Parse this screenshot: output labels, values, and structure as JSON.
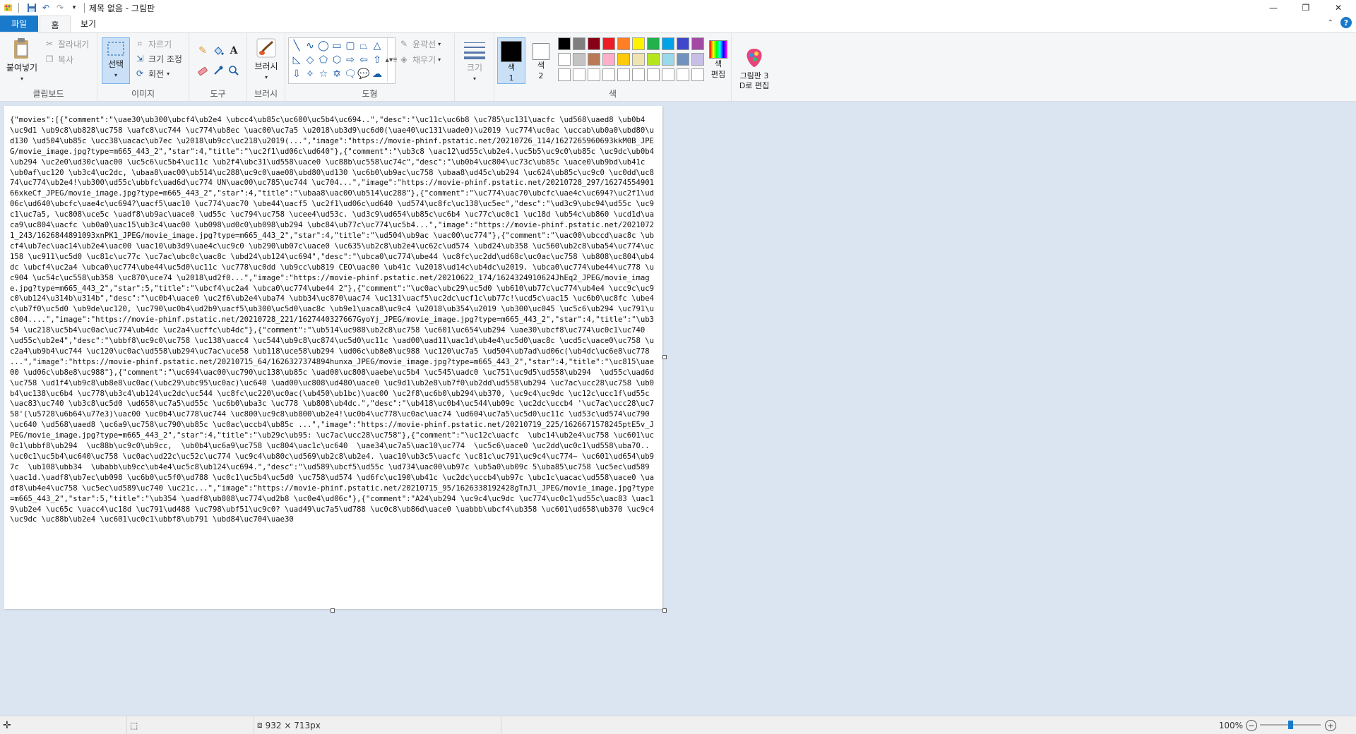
{
  "window": {
    "title": "제목 없음 - 그림판",
    "controls": [
      "—",
      "❐",
      "✕"
    ]
  },
  "tabs": {
    "file": "파일",
    "home": "홈",
    "view": "보기"
  },
  "clipboard": {
    "paste": "붙여넣기",
    "cut": "잘라내기",
    "copy": "복사",
    "label": "클립보드"
  },
  "image": {
    "select": "선택",
    "crop": "자르기",
    "resize": "크기 조정",
    "rotate": "회전",
    "label": "이미지"
  },
  "tools": {
    "label": "도구"
  },
  "brushes": {
    "label": "브러시"
  },
  "shapes": {
    "outline": "윤곽선",
    "fill": "채우기",
    "label": "도형"
  },
  "size": {
    "label": "크기"
  },
  "colors": {
    "color1": "색\n1",
    "color2": "색\n2",
    "edit": "색\n편집",
    "label": "색",
    "palette_row1": [
      "#000000",
      "#7f7f7f",
      "#880015",
      "#ed1c24",
      "#ff7f27",
      "#fff200",
      "#22b14c",
      "#00a2e8",
      "#3f48cc",
      "#a349a4"
    ],
    "palette_row2": [
      "#ffffff",
      "#c3c3c3",
      "#b97a57",
      "#ffaec9",
      "#ffc90e",
      "#efe4b0",
      "#b5e61d",
      "#99d9ea",
      "#7092be",
      "#c8bfe7"
    ],
    "palette_row3": [
      "#ffffff",
      "#ffffff",
      "#ffffff",
      "#ffffff",
      "#ffffff",
      "#ffffff",
      "#ffffff",
      "#ffffff",
      "#ffffff",
      "#ffffff"
    ]
  },
  "paint3d": {
    "label": "그림판 3\nD로 편집"
  },
  "canvas_text": "{\"movies\":[{\"comment\":\"\\uae30\\ub300\\ubcf4\\ub2e4 \\ubcc4\\ub85c\\uc600\\uc5b4\\uc694..\",\"desc\":\"\\uc11c\\uc6b8 \\uc785\\uc131\\uacfc \\ud568\\uaed8 \\ub0b4 \\uc9d1 \\ub9c8\\ub828\\uc758 \\uafc8\\uc744 \\uc774\\ub8ec \\uac00\\uc7a5 \\u2018\\ub3d9\\uc6d0(\\uae40\\uc131\\uade0)\\u2019 \\uc774\\uc0ac \\uccab\\ub0a0\\ubd80\\ud130 \\ud504\\ub85c \\ucc38\\uacac\\ub7ec \\u2018\\ub9cc\\uc218\\u2019(...\",\"image\":\"https://movie-phinf.pstatic.net/20210726_114/1627265960693kkM0B_JPEG/movie_image.jpg?type=m665_443_2\",\"star\":4,\"title\":\"\\uc2f1\\ud06c\\ud640\"},{\"comment\":\"\\ub3c8 \\uac12\\ud55c\\ub2e4.\\uc5b5\\uc9c0\\ub85c \\uc9dc\\ub0b4\\ub294 \\uc2e0\\ud30c\\uac00 \\uc5c6\\uc5b4\\uc11c \\ub2f4\\ubc31\\ud558\\uace0 \\uc88b\\uc558\\uc74c\",\"desc\":\"\\ub0b4\\uc804\\uc73c\\ub85c \\uace0\\ub9bd\\ub41c \\ub0af\\uc120 \\ub3c4\\uc2dc, \\ubaa8\\uac00\\ub514\\uc288\\uc9c0\\uae08\\ubd80\\ud130 \\uc6b0\\ub9ac\\uc758 \\ubaa8\\ud45c\\ub294 \\uc624\\ub85c\\uc9c0 \\uc0dd\\uc874\\uc774\\ub2e4!\\ub300\\ud55c\\ubbfc\\uad6d\\uc774 UN\\uac00\\uc785\\uc744 \\uc704...\",\"image\":\"https://movie-phinf.pstatic.net/20210728_297/1627455490166xkeCf_JPEG/movie_image.jpg?type=m665_443_2\",\"star\":4,\"title\":\"\\ubaa8\\uac00\\ub514\\uc288\"},{\"comment\":\"\\uc774\\uac70\\ubcfc\\uae4c\\uc694?\\uc2f1\\ud06c\\ud640\\ubcfc\\uae4c\\uc694?\\uacf5\\uac10 \\uc774\\uac70 \\ube44\\uacf5 \\uc2f1\\ud06c\\ud640 \\ud574\\uc8fc\\uc138\\uc5ec\",\"desc\":\"\\ud3c9\\ubc94\\ud55c \\uc9c1\\uc7a5, \\uc808\\uce5c \\uadf8\\ub9ac\\uace0 \\ud55c \\uc794\\uc758 \\ucee4\\ud53c. \\ud3c9\\ud654\\ub85c\\uc6b4 \\uc77c\\uc0c1 \\uc18d \\ub54c\\ub860 \\ucd1d\\uaca9\\uc804\\uacfc \\ub0a0\\uac15\\ub3c4\\uac00 \\ub098\\ud0c0\\ub098\\ub294 \\ubc84\\ub77c\\uc774\\uc5b4...\",\"image\":\"https://movie-phinf.pstatic.net/20210721_243/1626844891093xnPK1_JPEG/movie_image.jpg?type=m665_443_2\",\"star\":4,\"title\":\"\\ud504\\ub9ac \\uac00\\uc774\"},{\"comment\":\"\\uac00\\ubccd\\uac8c \\ubcf4\\ub7ec\\uac14\\ub2e4\\uac00 \\uac10\\ub3d9\\uae4c\\uc9c0 \\ub290\\ub07c\\uace0 \\uc635\\ub2c8\\ub2e4\\uc62c\\ud574 \\ubd24\\ub358 \\uc560\\ub2c8\\uba54\\uc774\\uc158 \\uc911\\uc5d0 \\uc81c\\uc77c \\uc7ac\\ubc0c\\uac8c \\ubd24\\ub124\\uc694\",\"desc\":\"\\ubca0\\uc774\\ube44 \\uc8fc\\uc2dd\\ud68c\\uc0ac\\uc758 \\ub808\\uc804\\ub4dc \\ubcf4\\uc2a4 \\ubca0\\uc774\\ube44\\uc5d0\\uc11c \\uc778\\uc0dd \\ub9cc\\ub819 CEO\\uac00 \\ub41c \\u2018\\ud14c\\ub4dc\\u2019. \\ubca0\\uc774\\ube44\\uc778 \\uc904 \\uc54c\\uc558\\ub358 \\uc870\\uce74 \\u2018\\ud2f0...\",\"image\":\"https://movie-phinf.pstatic.net/20210622_174/1624324910624JhEq2_JPEG/movie_image.jpg?type=m665_443_2\",\"star\":5,\"title\":\"\\ubcf4\\uc2a4 \\ubca0\\uc774\\ube44 2\"},{\"comment\":\"\\uc0ac\\ubc29\\uc5d0 \\ub610\\ub77c\\uc774\\ub4e4 \\ucc9c\\uc9c0\\ub124\\u314b\\u314b\",\"desc\":\"\\uc0b4\\uace0 \\uc2f6\\ub2e4\\uba74 \\ubb34\\uc870\\uac74 \\uc131\\uacf5\\uc2dc\\ucf1c\\ub77c!\\ucd5c\\uac15 \\uc6b0\\uc8fc \\ube4c\\ub7f0\\uc5d0 \\ub9de\\uc120, \\uc790\\uc0b4\\ud2b9\\uacf5\\ub300\\uc5d0\\uac8c \\ub9e1\\uaca8\\uc9c4 \\u2018\\ub354\\u2019 \\ub300\\uc045 \\uc5c6\\ub294 \\uc791\\uc804....\",\"image\":\"https://movie-phinf.pstatic.net/20210728_221/1627440327667GyoYj_JPEG/movie_image.jpg?type=m665_443_2\",\"star\":4,\"title\":\"\\ub354 \\uc218\\uc5b4\\uc0ac\\uc774\\ub4dc \\uc2a4\\ucffc\\ub4dc\"},{\"comment\":\"\\ub514\\uc988\\ub2c8\\uc758 \\uc601\\uc654\\ub294 \\uae30\\ubcf8\\uc774\\uc0c1\\uc740 \\ud55c\\ub2e4\",\"desc\":\"\\ubbf8\\uc9c0\\uc758 \\uc138\\uacc4 \\uc544\\ub9c8\\uc874\\uc5d0\\uc11c \\uad00\\uad11\\uac1d\\ub4e4\\uc5d0\\uac8c \\ucd5c\\uace0\\uc758 \\uc2a4\\ub9b4\\uc744 \\uc120\\uc0ac\\ud558\\ub294\\uc7ac\\uce58 \\ub118\\uce58\\ub294 \\ud06c\\ub8e8\\uc988 \\uc120\\uc7a5 \\ud504\\ub7ad\\ud06c(\\ub4dc\\uc6e8\\uc778 ...\",\"image\":\"https://movie-phinf.pstatic.net/20210715_64/1626327374894hunxa_JPEG/movie_image.jpg?type=m665_443_2\",\"star\":4,\"title\":\"\\uc815\\uae00 \\ud06c\\ub8e8\\uc988\"},{\"comment\":\"\\uc694\\uac00\\uc790\\uc138\\ub85c \\uad00\\uc808\\uaebe\\uc5b4 \\uc545\\uadc0 \\uc751\\uc9d5\\ud558\\ub294  \\ud55c\\uad6d\\uc758 \\ud1f4\\ub9c8\\ub8e8\\uc0ac(\\ubc29\\ubc95\\uc0ac)\\uc640 \\uad00\\uc808\\ud480\\uace0 \\uc9d1\\ub2e8\\ub7f0\\ub2dd\\ud558\\ub294 \\uc7ac\\ucc28\\uc758 \\ub0b4\\uc138\\uc6b4 \\uc778\\ub3c4\\ub124\\uc2dc\\uc544 \\uc8fc\\uc220\\uc0ac(\\ub450\\ub1bc)\\uac00 \\uc2f8\\uc6b0\\ub294\\ub370, \\uc9c4\\uc9dc \\uc12c\\ucc1f\\ud55c \\uac83\\uc740 \\ub3c8\\uc5d0 \\ud658\\uc7a5\\ud55c \\uc6b0\\uba3c \\uc778 \\ub808\\ub4dc.\",\"desc\":\"\\ub418\\uc0b4\\uc544\\ub09c \\uc2dc\\uccb4 '\\uc7ac\\ucc28\\uc758'(\\u5728\\u6b64\\u77e3)\\uac00 \\uc0b4\\uc778\\uc744 \\uc800\\uc9c8\\ub800\\ub2e4!\\uc0b4\\uc778\\uc0ac\\uac74 \\ud604\\uc7a5\\uc5d0\\uc11c \\ud53c\\ud574\\uc790\\uc640 \\ud568\\uaed8 \\uc6a9\\uc758\\uc790\\ub85c \\uc0ac\\uccb4\\ub85c ...\",\"image\":\"https://movie-phinf.pstatic.net/20210719_225/1626671578245ptE5v_JPEG/movie_image.jpg?type=m665_443_2\",\"star\":4,\"title\":\"\\ub29c\\ub95: \\uc7ac\\ucc28\\uc758\"},{\"comment\":\"\\uc12c\\uacfc  \\ubc14\\ub2e4\\uc758 \\uc601\\uc0c1\\ubbf8\\ub294  \\uc88b\\uc9c0\\ub9cc,  \\ub0b4\\uc6a9\\uc758 \\uc804\\uac1c\\uc640  \\uae34\\uc7a5\\uac10\\uc774  \\uc5c6\\uace0 \\uc2dd\\uc0c1\\ud558\\uba70.. \\uc0c1\\uc5b4\\uc640\\uc758 \\uc0ac\\ud22c\\uc52c\\uc774 \\uc9c4\\ub80c\\ud569\\ub2c8\\ub2e4. \\uac10\\ub3c5\\uacfc \\uc81c\\uc791\\uc9c4\\uc774~ \\uc601\\ud654\\ub97c  \\ub108\\ubb34  \\ubabb\\ub9cc\\ub4e4\\uc5c8\\ub124\\uc694.\",\"desc\":\"\\ud589\\ubcf5\\ud55c \\ud734\\uac00\\ub97c \\ub5a0\\ub09c 5\\uba85\\uc758 \\uc5ec\\ud589\\uac1d.\\uadf8\\ub7ec\\ub098 \\uc6b0\\uc5f0\\ud788 \\uc0c1\\uc5b4\\uc5d0 \\uc758\\ud574 \\ud6fc\\uc190\\ub41c \\uc2dc\\uccb4\\ub97c \\ubc1c\\uacac\\ud558\\uace0 \\uadf8\\ub4e4\\uc758 \\uc5ec\\ud589\\uc740 \\uc21c...\",\"image\":\"https://movie-phinf.pstatic.net/20210715_95/1626338192428gTnJl_JPEG/movie_image.jpg?type=m665_443_2\",\"star\":5,\"title\":\"\\ub354 \\uadf8\\ub808\\uc774\\ud2b8 \\uc0e4\\ud06c\"},{\"comment\":\"A24\\ub294 \\uc9c4\\uc9dc \\uc774\\uc0c1\\ud55c\\uac83 \\uac19\\ub2e4 \\uc65c \\uacc4\\uc18d \\uc791\\ud488 \\uc798\\ubf51\\uc9c0? \\uad49\\uc7a5\\ud788 \\uc0c8\\ub86d\\uace0 \\uabbb\\ubcf4\\ub358 \\uc601\\ud658\\ub370 \\uc9c4\\uc9dc \\uc88b\\ub2e4 \\uc601\\uc0c1\\ubbf8\\ub791 \\ubd84\\uc704\\uae30",
  "statusbar": {
    "dimensions": "932 × 713px",
    "zoom": "100%",
    "zoom_level": 1.0
  }
}
